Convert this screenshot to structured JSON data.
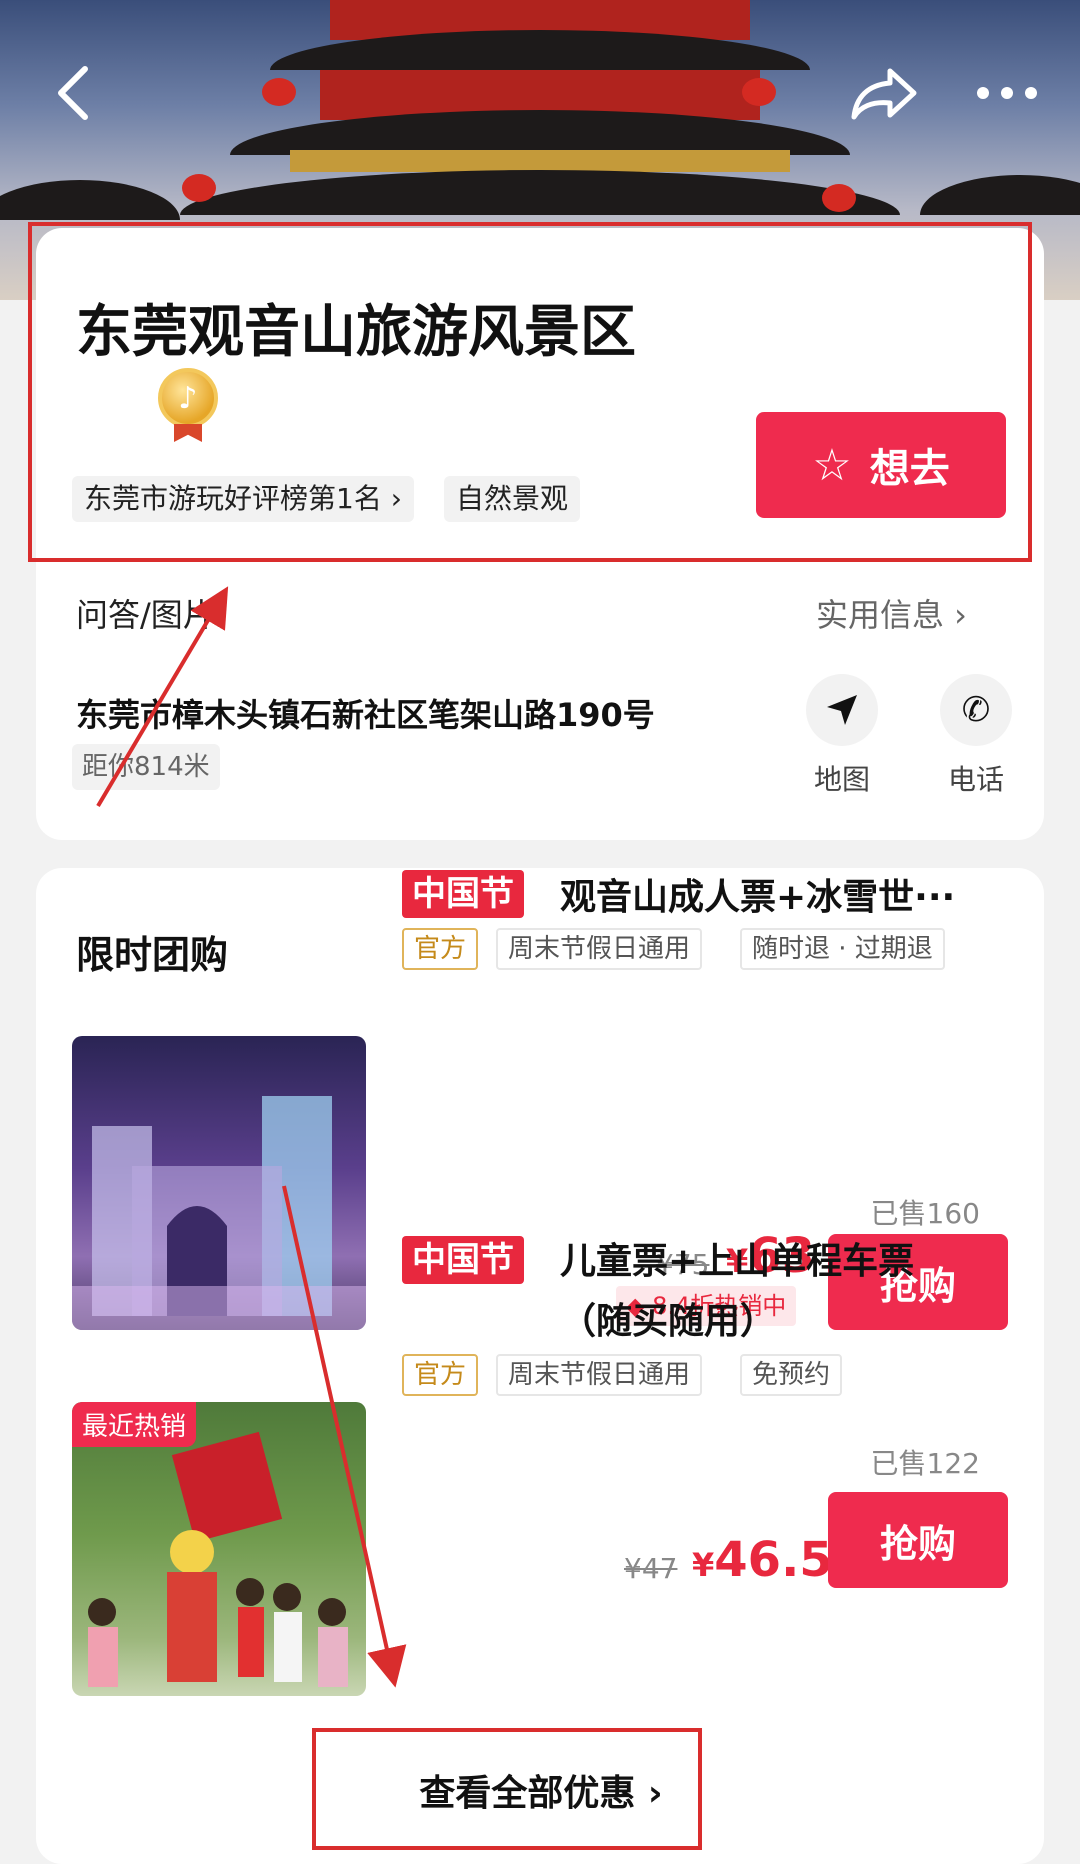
{
  "nav": {
    "back_icon": "chevron-left-icon",
    "share_icon": "share-arrow-icon",
    "more_icon": "more-dots-icon"
  },
  "attraction": {
    "title": "东莞观音山旅游风景区",
    "medal_icon": "douyin-medal-icon",
    "rank_tag": "东莞市游玩好评榜第1名 ›",
    "category_tag": "自然景观",
    "want_label": "想去",
    "qa_label": "问答/图片",
    "info_label": "实用信息 ›",
    "address": "东莞市樟木头镇石新社区笔架山路190号",
    "distance": "距你814米",
    "map_label": "地图",
    "phone_label": "电话"
  },
  "deals": {
    "section_title": "限时团购",
    "items": [
      {
        "festival_tag": "中国节",
        "name": "观音山成人票+冰雪世···",
        "chips": [
          "官方",
          "周末节假日通用",
          "随时退 · 过期退"
        ],
        "sold": "已售160",
        "old_price": "¥75",
        "currency": "¥",
        "price": "63",
        "discount": "8.4折热销中",
        "buy_label": "抢购"
      },
      {
        "badge": "最近热销",
        "festival_tag": "中国节",
        "name_line1": "儿童票+上山单程车票",
        "name_line2": "（随买随用）",
        "chips": [
          "官方",
          "周末节假日通用",
          "免预约"
        ],
        "sold": "已售122",
        "old_price": "¥47",
        "currency": "¥",
        "price": "46.5",
        "buy_label": "抢购"
      }
    ],
    "view_all": "查看全部优惠 ›"
  },
  "colors": {
    "accent": "#ef2b4e",
    "annotation": "#d92d2d",
    "official": "#c58a1a"
  }
}
